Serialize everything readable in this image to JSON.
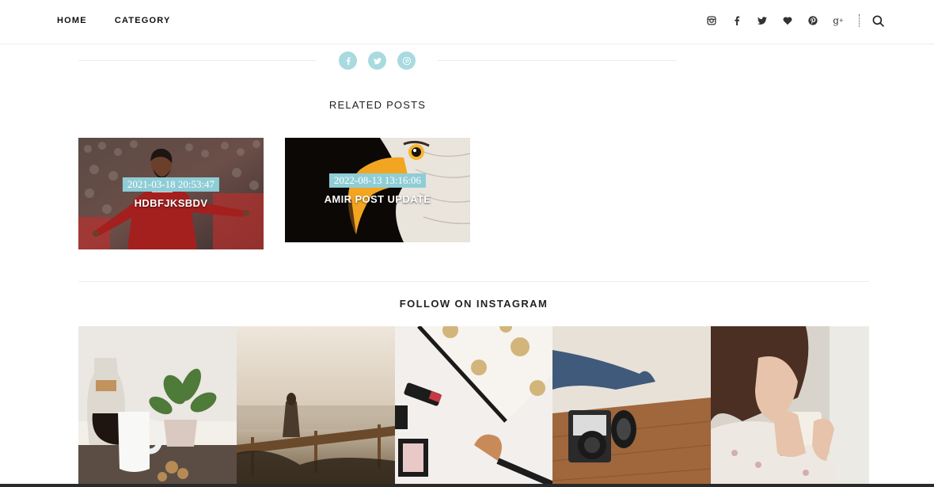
{
  "nav": {
    "items": [
      {
        "label": "HOME"
      },
      {
        "label": "CATEGORY"
      }
    ]
  },
  "header_social": {
    "icons": [
      "instagram-icon",
      "facebook-icon",
      "twitter-icon",
      "heart-icon",
      "pinterest-icon",
      "google-plus-icon"
    ],
    "search_icon": "search-icon"
  },
  "share": {
    "icons": [
      "facebook-icon",
      "twitter-icon",
      "pinterest-icon"
    ],
    "color": "#a8dae0"
  },
  "related": {
    "title": "RELATED POSTS",
    "posts": [
      {
        "date": "2021-03-18 20:53:47",
        "title": "HDBFJKSBDV"
      },
      {
        "date": "2022-08-13 13:16:06",
        "title": "AMIR POST UPDATE"
      }
    ],
    "date_badge_color": "#8fcdd6"
  },
  "instagram": {
    "title": "FOLLOW ON INSTAGRAM",
    "photos": [
      "coffee-and-plant",
      "woman-at-seaside",
      "makeup-and-pouch",
      "camera-on-table",
      "woman-with-cup"
    ]
  }
}
